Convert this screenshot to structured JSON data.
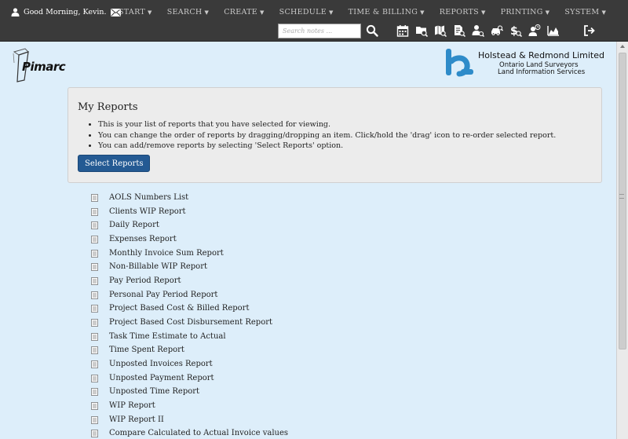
{
  "header": {
    "greeting": "Good Morning, Kevin.",
    "menu": [
      "START",
      "SEARCH",
      "CREATE",
      "SCHEDULE",
      "TIME & BILLING",
      "REPORTS",
      "PRINTING",
      "SYSTEM"
    ],
    "search_placeholder": "Search notes ...",
    "toolbar_icons": [
      "calendar-icon",
      "folder-search-icon",
      "map-search-icon",
      "document-search-icon",
      "user-search-icon",
      "car-search-icon",
      "dollar-search-icon",
      "user-clock-icon",
      "chart-icon"
    ],
    "logout_icon": "logout-icon"
  },
  "branding": {
    "app_logo": "Pimarc",
    "company_name": "Holstead & Redmond Limited",
    "company_line1": "Ontario Land Surveyors",
    "company_line2": "Land Information Services",
    "accent": "#2e8bc9"
  },
  "panel": {
    "title": "My Reports",
    "bullets": [
      "This is your list of reports that you have selected for viewing.",
      "You can change the order of reports by dragging/dropping an item. Click/hold the 'drag' icon to re-order selected report.",
      "You can add/remove reports by selecting 'Select Reports' option."
    ],
    "button_label": "Select Reports",
    "button_color": "#245a93"
  },
  "reports": [
    "AOLS Numbers List",
    "Clients WIP Report",
    "Daily Report",
    "Expenses Report",
    "Monthly Invoice Sum Report",
    "Non-Billable WIP Report",
    "Pay Period Report",
    "Personal Pay Period Report",
    "Project Based Cost & Billed Report",
    "Project Based Cost Disbursement Report",
    "Task Time Estimate to Actual",
    "Time Spent Report",
    "Unposted Invoices Report",
    "Unposted Payment Report",
    "Unposted Time Report",
    "WIP Report",
    "WIP Report II",
    "Compare Calculated to Actual Invoice values"
  ]
}
